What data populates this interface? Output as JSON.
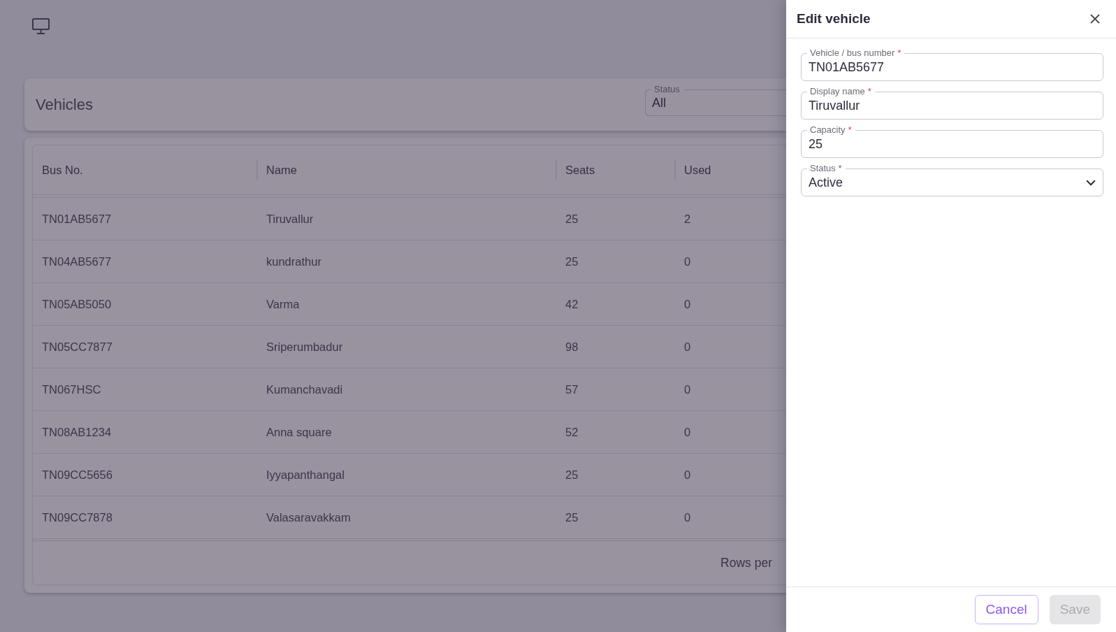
{
  "page": {
    "title": "Vehicles",
    "status_filter": {
      "label": "Status",
      "value": "All"
    }
  },
  "table": {
    "columns": [
      "Bus No.",
      "Name",
      "Seats",
      "Used"
    ],
    "rows": [
      [
        "TN01AB5677",
        "Tiruvallur",
        "25",
        "2"
      ],
      [
        "TN04AB5677",
        "kundrathur",
        "25",
        "0"
      ],
      [
        "TN05AB5050",
        "Varma",
        "42",
        "0"
      ],
      [
        "TN05CC7877",
        "Sriperumbadur",
        "98",
        "0"
      ],
      [
        "TN067HSC",
        "Kumanchavadi",
        "57",
        "0"
      ],
      [
        "TN08AB1234",
        "Anna square",
        "52",
        "0"
      ],
      [
        "TN09CC5656",
        "Iyyapanthangal",
        "25",
        "0"
      ],
      [
        "TN09CC7878",
        "Valasaravakkam",
        "25",
        "0"
      ]
    ],
    "footer_text": "Rows per"
  },
  "drawer": {
    "title": "Edit vehicle",
    "fields": [
      {
        "kind": "text",
        "label": "Vehicle / bus number",
        "required_mark": "*",
        "value": "TN01AB5677"
      },
      {
        "kind": "text",
        "label": "Display name",
        "required_mark": "*",
        "value": "Tiruvallur"
      },
      {
        "kind": "text",
        "label": "Capacity",
        "required_mark": "*",
        "value": "25"
      },
      {
        "kind": "select",
        "label": "Status *",
        "value": "Active"
      }
    ],
    "buttons": [
      {
        "label": "Cancel",
        "kind": "outlined",
        "disabled": false
      },
      {
        "label": "Save",
        "kind": "contained",
        "disabled": true
      }
    ]
  }
}
